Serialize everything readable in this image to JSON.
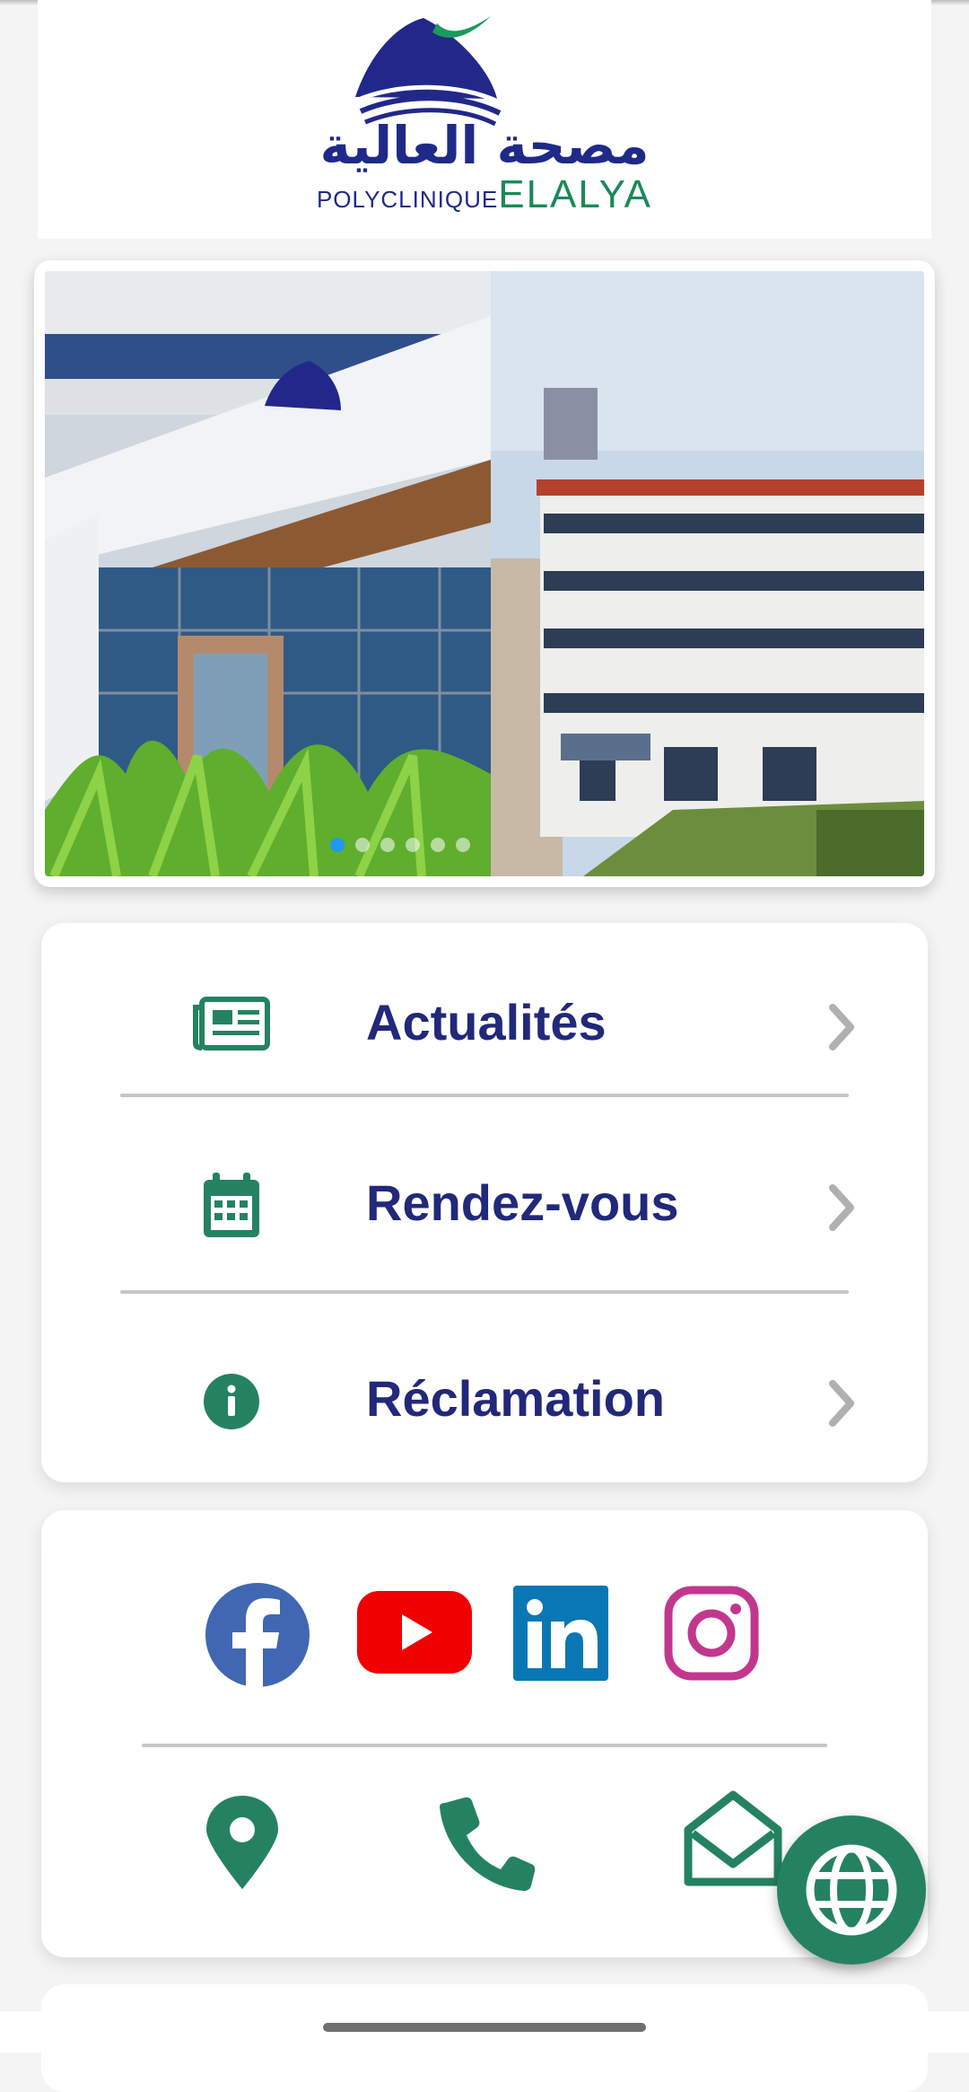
{
  "header": {
    "logo_arabic": "مصحة العالية",
    "logo_small": "POLYCLINIQUE",
    "logo_big": "ELALYA"
  },
  "slider": {
    "images": [
      "building-entrance-photo",
      "building-exterior-photo"
    ],
    "slide_count": 6,
    "active_slide": 1
  },
  "menu": {
    "items": [
      {
        "label": "Actualités",
        "icon": "newspaper-icon"
      },
      {
        "label": "Rendez-vous",
        "icon": "calendar-icon"
      },
      {
        "label": "Réclamation",
        "icon": "info-icon"
      }
    ]
  },
  "social": {
    "networks": [
      "facebook-icon",
      "youtube-icon",
      "linkedin-icon",
      "instagram-icon"
    ],
    "contacts": [
      "map-pin-icon",
      "phone-icon",
      "email-icon"
    ]
  },
  "fab": {
    "icon": "globe-icon"
  },
  "colors": {
    "primary_green": "#258260",
    "navy_text": "#22287a",
    "facebook": "#4267b2",
    "youtube": "#f00000",
    "linkedin": "#0a77b5",
    "instagram": "#c2378e"
  }
}
